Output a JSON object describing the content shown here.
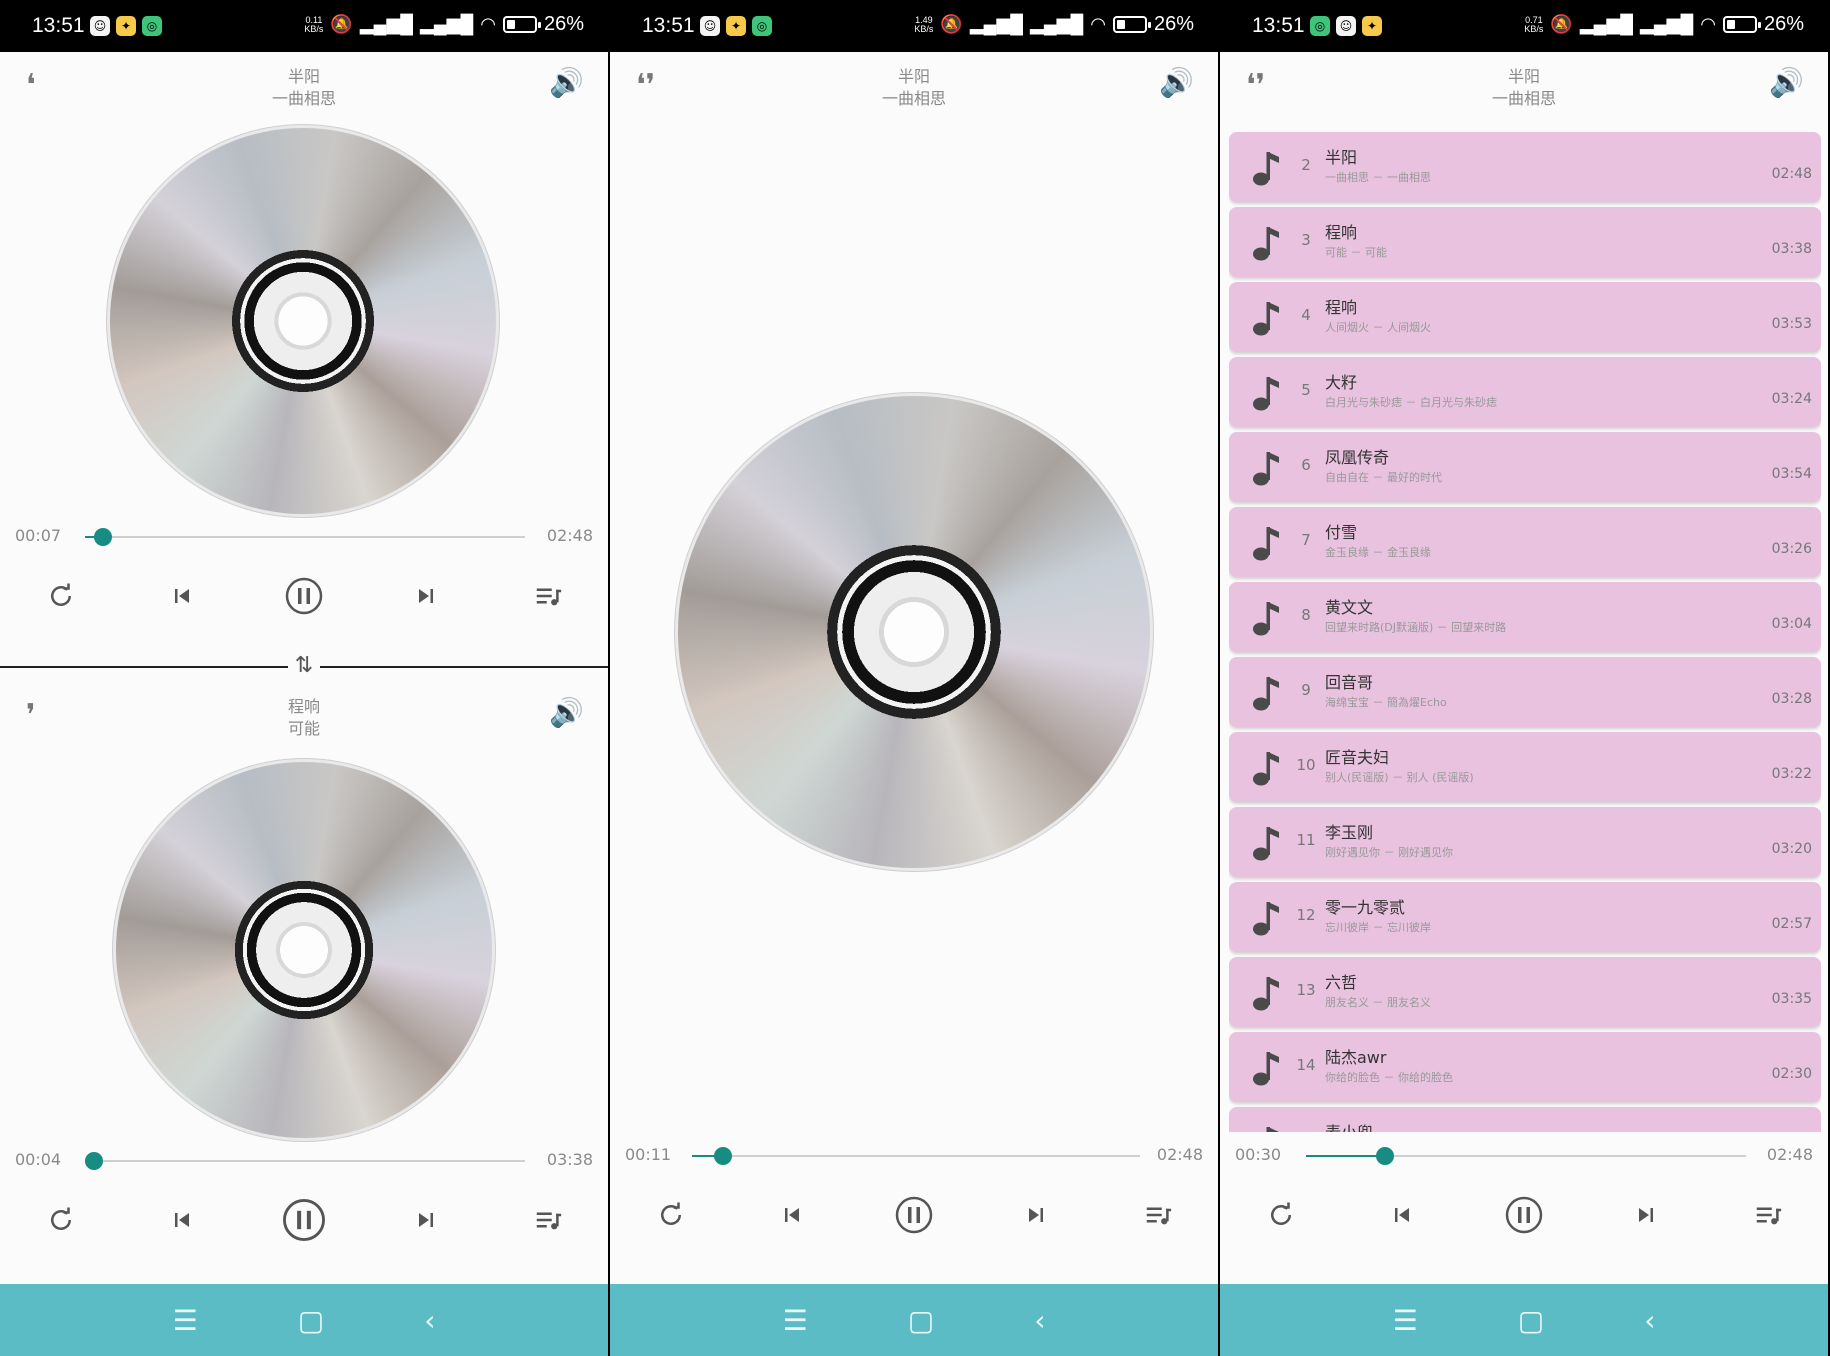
{
  "status": {
    "time": "13:51",
    "battery": "26%",
    "speeds": [
      "0.11",
      "1.49",
      "0.71"
    ],
    "speed_unit": "KB/s"
  },
  "screen1": {
    "top": {
      "artist": "半阳",
      "title": "一曲相思",
      "current": "00:07",
      "total": "02:48",
      "progress": 0.04
    },
    "bottom": {
      "artist": "程响",
      "title": "可能",
      "current": "00:04",
      "total": "03:38",
      "progress": 0.02
    }
  },
  "screen2": {
    "artist": "半阳",
    "title": "一曲相思",
    "current": "00:11",
    "total": "02:48",
    "progress": 0.07
  },
  "screen3": {
    "artist": "半阳",
    "title": "一曲相思",
    "current": "00:30",
    "total": "02:48",
    "progress": 0.18,
    "songs": [
      {
        "num": "2",
        "name": "半阳",
        "info": "一曲相思 － 一曲相思",
        "dur": "02:48"
      },
      {
        "num": "3",
        "name": "程响",
        "info": "可能 － 可能",
        "dur": "03:38"
      },
      {
        "num": "4",
        "name": "程响",
        "info": "人间烟火 － 人间烟火",
        "dur": "03:53"
      },
      {
        "num": "5",
        "name": "大籽",
        "info": "白月光与朱砂痣 － 白月光与朱砂痣",
        "dur": "03:24"
      },
      {
        "num": "6",
        "name": "凤凰传奇",
        "info": "自由自在 － 最好的时代",
        "dur": "03:54"
      },
      {
        "num": "7",
        "name": "付雪",
        "info": "金玉良缘 － 金玉良缘",
        "dur": "03:26"
      },
      {
        "num": "8",
        "name": "黄文文",
        "info": "回望来时路(DJ默涵版) － 回望来时路",
        "dur": "03:04"
      },
      {
        "num": "9",
        "name": "回音哥",
        "info": "海绵宝宝 － 簡為燿Echo",
        "dur": "03:28"
      },
      {
        "num": "10",
        "name": "匠音夫妇",
        "info": "别人(民谣版) － 别人 (民谣版)",
        "dur": "03:22"
      },
      {
        "num": "11",
        "name": "李玉刚",
        "info": "刚好遇见你 － 刚好遇见你",
        "dur": "03:20"
      },
      {
        "num": "12",
        "name": "零一九零贰",
        "info": "忘川彼岸 － 忘川彼岸",
        "dur": "02:57"
      },
      {
        "num": "13",
        "name": "六哲",
        "info": "朋友名义 － 朋友名义",
        "dur": "03:35"
      },
      {
        "num": "14",
        "name": "陆杰awr",
        "info": "你给的脸色 － 你给的脸色",
        "dur": "02:30"
      },
      {
        "num": "",
        "name": "麦小兜",
        "info": "",
        "dur": ""
      }
    ]
  },
  "colors": {
    "accent": "#168c83",
    "list_item": "#e8c2df",
    "navbar": "#5bbcc5"
  },
  "icons": {
    "earphone": "earphone-icon",
    "volume": "volume-icon",
    "repeat": "repeat-icon",
    "previous": "previous-icon",
    "pause": "pause-icon",
    "next": "next-icon",
    "playlist": "playlist-icon",
    "note": "music-note-icon",
    "swap": "swap-icon"
  }
}
